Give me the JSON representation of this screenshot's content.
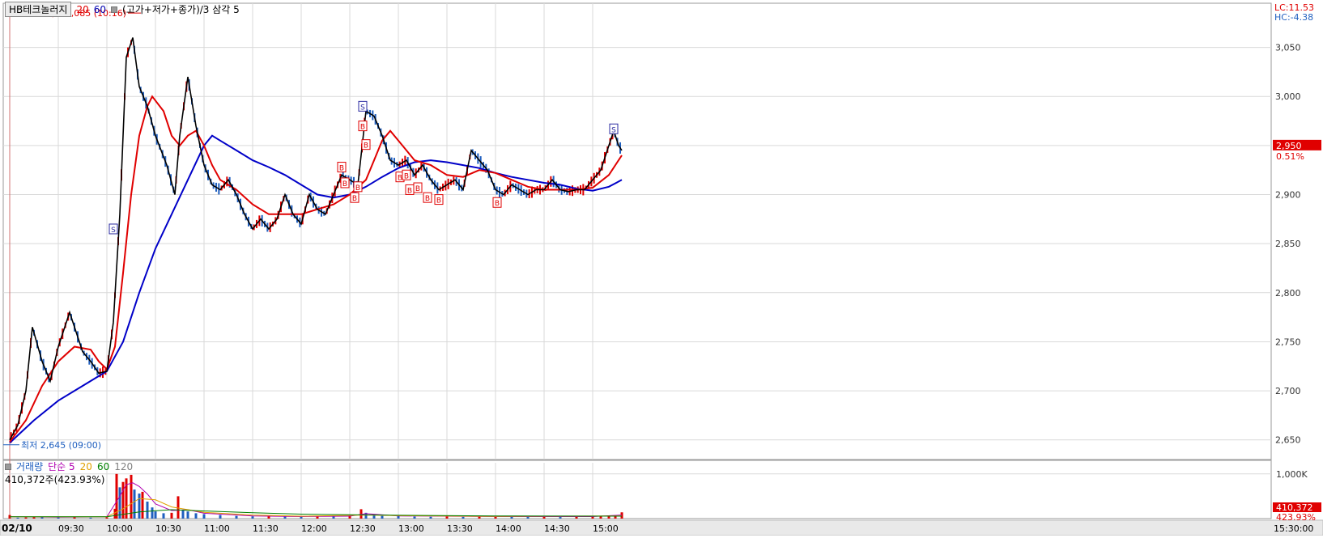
{
  "header": {
    "stock_name": "HB테크놀러지",
    "ma_short": "20",
    "ma_long": "60",
    "indicator": "(고가+저가+종가)/3 삼각 5",
    "lc_label": "LC:11.53",
    "hc_label": "HC:-4.38",
    "last_price_label": "2,950",
    "last_change_label": "0.51%",
    "high_annotation": "최고 3,085 (10:16)",
    "low_annotation": "최저 2,645 (09:00)"
  },
  "volume_panel": {
    "legend_title": "거래량",
    "legend_ma": "단순 5",
    "legend_20": "20",
    "legend_60": "60",
    "legend_120": "120",
    "summary": "410,372주(423.93%)",
    "axis_label": "1,000K",
    "last_volume_label": "410,372",
    "last_ratio_label": "423.93%"
  },
  "colors": {
    "up": "#e00000",
    "down": "#1f5fbf",
    "ma20": "#e00000",
    "ma60": "#0000c8",
    "triangle5": "#000000",
    "grid": "#d9d9d9"
  },
  "chart_data": {
    "type": "line",
    "date_label": "02/10",
    "x_ticks": [
      "09:30",
      "10:00",
      "10:30",
      "11:00",
      "11:30",
      "12:00",
      "12:30",
      "13:00",
      "13:30",
      "14:00",
      "14:30",
      "15:00",
      "15:30:00"
    ],
    "y_ticks": [
      2650,
      2700,
      2750,
      2800,
      2850,
      2900,
      2950,
      3000,
      3050
    ],
    "y_tick_labels": [
      "2,650",
      "2,700",
      "2,750",
      "2,800",
      "2,850",
      "2,900",
      "2,950",
      "3,000",
      "3,050"
    ],
    "ylim": [
      2630,
      3095
    ],
    "xlim": [
      "09:00",
      "15:30"
    ],
    "high": {
      "time": "10:16",
      "value": 3085
    },
    "low": {
      "time": "09:00",
      "value": 2645
    },
    "price_path": [
      [
        "09:00",
        2650
      ],
      [
        "09:05",
        2665
      ],
      [
        "09:10",
        2700
      ],
      [
        "09:14",
        2765
      ],
      [
        "09:20",
        2730
      ],
      [
        "09:25",
        2710
      ],
      [
        "09:30",
        2745
      ],
      [
        "09:37",
        2780
      ],
      [
        "09:45",
        2740
      ],
      [
        "09:50",
        2730
      ],
      [
        "09:55",
        2718
      ],
      [
        "10:00",
        2720
      ],
      [
        "10:04",
        2770
      ],
      [
        "10:08",
        2880
      ],
      [
        "10:12",
        3040
      ],
      [
        "10:16",
        3060
      ],
      [
        "10:20",
        3010
      ],
      [
        "10:25",
        2990
      ],
      [
        "10:30",
        2960
      ],
      [
        "10:37",
        2930
      ],
      [
        "10:42",
        2900
      ],
      [
        "10:45",
        2960
      ],
      [
        "10:50",
        3020
      ],
      [
        "10:55",
        2970
      ],
      [
        "11:00",
        2930
      ],
      [
        "11:05",
        2910
      ],
      [
        "11:10",
        2905
      ],
      [
        "11:15",
        2915
      ],
      [
        "11:20",
        2900
      ],
      [
        "11:25",
        2880
      ],
      [
        "11:30",
        2865
      ],
      [
        "11:35",
        2875
      ],
      [
        "11:40",
        2865
      ],
      [
        "11:45",
        2875
      ],
      [
        "11:50",
        2900
      ],
      [
        "11:55",
        2880
      ],
      [
        "12:00",
        2870
      ],
      [
        "12:05",
        2900
      ],
      [
        "12:10",
        2885
      ],
      [
        "12:15",
        2880
      ],
      [
        "12:20",
        2900
      ],
      [
        "12:25",
        2920
      ],
      [
        "12:30",
        2915
      ],
      [
        "12:35",
        2910
      ],
      [
        "12:40",
        2985
      ],
      [
        "12:45",
        2980
      ],
      [
        "12:50",
        2960
      ],
      [
        "12:55",
        2935
      ],
      [
        "13:00",
        2930
      ],
      [
        "13:05",
        2935
      ],
      [
        "13:10",
        2920
      ],
      [
        "13:15",
        2930
      ],
      [
        "13:20",
        2915
      ],
      [
        "13:25",
        2905
      ],
      [
        "13:30",
        2910
      ],
      [
        "13:35",
        2915
      ],
      [
        "13:40",
        2905
      ],
      [
        "13:45",
        2945
      ],
      [
        "13:50",
        2935
      ],
      [
        "13:55",
        2925
      ],
      [
        "14:00",
        2905
      ],
      [
        "14:05",
        2900
      ],
      [
        "14:10",
        2910
      ],
      [
        "14:15",
        2905
      ],
      [
        "14:20",
        2900
      ],
      [
        "14:25",
        2905
      ],
      [
        "14:30",
        2905
      ],
      [
        "14:35",
        2915
      ],
      [
        "14:40",
        2905
      ],
      [
        "14:45",
        2903
      ],
      [
        "14:50",
        2905
      ],
      [
        "14:55",
        2905
      ],
      [
        "15:00",
        2915
      ],
      [
        "15:05",
        2925
      ],
      [
        "15:10",
        2950
      ],
      [
        "15:13",
        2965
      ],
      [
        "15:16",
        2950
      ],
      [
        "15:18",
        2945
      ]
    ],
    "series": [
      {
        "name": "20",
        "values": [
          [
            "09:00",
            2648
          ],
          [
            "09:10",
            2670
          ],
          [
            "09:20",
            2705
          ],
          [
            "09:30",
            2730
          ],
          [
            "09:40",
            2745
          ],
          [
            "09:50",
            2742
          ],
          [
            "09:55",
            2730
          ],
          [
            "10:00",
            2722
          ],
          [
            "10:05",
            2745
          ],
          [
            "10:10",
            2820
          ],
          [
            "10:15",
            2900
          ],
          [
            "10:20",
            2960
          ],
          [
            "10:25",
            2990
          ],
          [
            "10:28",
            3000
          ],
          [
            "10:35",
            2985
          ],
          [
            "10:40",
            2960
          ],
          [
            "10:45",
            2950
          ],
          [
            "10:50",
            2960
          ],
          [
            "10:55",
            2965
          ],
          [
            "11:00",
            2950
          ],
          [
            "11:05",
            2930
          ],
          [
            "11:10",
            2915
          ],
          [
            "11:20",
            2905
          ],
          [
            "11:30",
            2890
          ],
          [
            "11:40",
            2880
          ],
          [
            "11:50",
            2880
          ],
          [
            "12:00",
            2880
          ],
          [
            "12:10",
            2885
          ],
          [
            "12:20",
            2890
          ],
          [
            "12:30",
            2900
          ],
          [
            "12:40",
            2915
          ],
          [
            "12:45",
            2935
          ],
          [
            "12:50",
            2955
          ],
          [
            "12:55",
            2965
          ],
          [
            "13:00",
            2955
          ],
          [
            "13:05",
            2945
          ],
          [
            "13:10",
            2935
          ],
          [
            "13:20",
            2930
          ],
          [
            "13:30",
            2920
          ],
          [
            "13:40",
            2918
          ],
          [
            "13:50",
            2925
          ],
          [
            "14:00",
            2922
          ],
          [
            "14:10",
            2915
          ],
          [
            "14:20",
            2908
          ],
          [
            "14:30",
            2905
          ],
          [
            "14:40",
            2905
          ],
          [
            "14:50",
            2905
          ],
          [
            "15:00",
            2907
          ],
          [
            "15:10",
            2920
          ],
          [
            "15:18",
            2940
          ]
        ]
      },
      {
        "name": "60",
        "values": [
          [
            "09:00",
            2647
          ],
          [
            "09:15",
            2670
          ],
          [
            "09:30",
            2690
          ],
          [
            "09:45",
            2705
          ],
          [
            "10:00",
            2720
          ],
          [
            "10:10",
            2750
          ],
          [
            "10:20",
            2800
          ],
          [
            "10:30",
            2845
          ],
          [
            "10:40",
            2880
          ],
          [
            "10:50",
            2915
          ],
          [
            "11:00",
            2950
          ],
          [
            "11:05",
            2960
          ],
          [
            "11:10",
            2955
          ],
          [
            "11:20",
            2945
          ],
          [
            "11:30",
            2935
          ],
          [
            "11:40",
            2928
          ],
          [
            "11:50",
            2920
          ],
          [
            "12:00",
            2910
          ],
          [
            "12:10",
            2900
          ],
          [
            "12:20",
            2897
          ],
          [
            "12:30",
            2900
          ],
          [
            "12:40",
            2908
          ],
          [
            "12:50",
            2918
          ],
          [
            "13:00",
            2927
          ],
          [
            "13:10",
            2933
          ],
          [
            "13:20",
            2935
          ],
          [
            "13:30",
            2933
          ],
          [
            "13:40",
            2930
          ],
          [
            "13:50",
            2927
          ],
          [
            "14:00",
            2922
          ],
          [
            "14:10",
            2918
          ],
          [
            "14:20",
            2915
          ],
          [
            "14:30",
            2912
          ],
          [
            "14:40",
            2910
          ],
          [
            "14:50",
            2906
          ],
          [
            "15:00",
            2904
          ],
          [
            "15:10",
            2908
          ],
          [
            "15:18",
            2915
          ]
        ]
      }
    ],
    "signals": [
      {
        "type": "S",
        "time": "10:04",
        "value": 2865
      },
      {
        "type": "S",
        "time": "12:38",
        "value": 2990
      },
      {
        "type": "S",
        "time": "15:13",
        "value": 2967
      },
      {
        "type": "B",
        "time": "12:25",
        "value": 2928
      },
      {
        "type": "B",
        "time": "12:27",
        "value": 2912
      },
      {
        "type": "B",
        "time": "12:33",
        "value": 2897
      },
      {
        "type": "B",
        "time": "12:35",
        "value": 2908
      },
      {
        "type": "B",
        "time": "12:38",
        "value": 2970
      },
      {
        "type": "B",
        "time": "12:40",
        "value": 2951
      },
      {
        "type": "B",
        "time": "13:01",
        "value": 2918
      },
      {
        "type": "B",
        "time": "13:05",
        "value": 2920
      },
      {
        "type": "B",
        "time": "13:07",
        "value": 2905
      },
      {
        "type": "B",
        "time": "13:12",
        "value": 2907
      },
      {
        "type": "B",
        "time": "13:18",
        "value": 2897
      },
      {
        "type": "B",
        "time": "13:25",
        "value": 2895
      },
      {
        "type": "B",
        "time": "14:01",
        "value": 2892
      }
    ],
    "volume": {
      "ylabel_tick": "1,000K",
      "ylim_k": [
        0,
        1250
      ],
      "bars_k": [
        [
          "09:00",
          80
        ],
        [
          "09:05",
          20
        ],
        [
          "09:10",
          25
        ],
        [
          "09:15",
          40
        ],
        [
          "09:20",
          30
        ],
        [
          "09:30",
          25
        ],
        [
          "09:40",
          35
        ],
        [
          "09:50",
          20
        ],
        [
          "10:00",
          30
        ],
        [
          "10:05",
          220
        ],
        [
          "10:06",
          1000
        ],
        [
          "10:08",
          700
        ],
        [
          "10:10",
          820
        ],
        [
          "10:12",
          900
        ],
        [
          "10:15",
          980
        ],
        [
          "10:17",
          650
        ],
        [
          "10:20",
          560
        ],
        [
          "10:22",
          600
        ],
        [
          "10:25",
          380
        ],
        [
          "10:28",
          250
        ],
        [
          "10:30",
          160
        ],
        [
          "10:35",
          120
        ],
        [
          "10:40",
          130
        ],
        [
          "10:44",
          500
        ],
        [
          "10:47",
          200
        ],
        [
          "10:50",
          160
        ],
        [
          "10:55",
          120
        ],
        [
          "11:00",
          100
        ],
        [
          "11:10",
          80
        ],
        [
          "11:20",
          60
        ],
        [
          "11:30",
          50
        ],
        [
          "11:40",
          55
        ],
        [
          "11:50",
          45
        ],
        [
          "12:00",
          40
        ],
        [
          "12:10",
          50
        ],
        [
          "12:20",
          45
        ],
        [
          "12:30",
          60
        ],
        [
          "12:37",
          210
        ],
        [
          "12:40",
          130
        ],
        [
          "12:45",
          70
        ],
        [
          "12:50",
          60
        ],
        [
          "13:00",
          55
        ],
        [
          "13:10",
          45
        ],
        [
          "13:20",
          40
        ],
        [
          "13:30",
          45
        ],
        [
          "13:40",
          40
        ],
        [
          "13:50",
          45
        ],
        [
          "14:00",
          50
        ],
        [
          "14:10",
          40
        ],
        [
          "14:20",
          35
        ],
        [
          "14:30",
          40
        ],
        [
          "14:40",
          35
        ],
        [
          "14:50",
          40
        ],
        [
          "15:00",
          45
        ],
        [
          "15:05",
          50
        ],
        [
          "15:10",
          60
        ],
        [
          "15:14",
          70
        ],
        [
          "15:18",
          140
        ]
      ],
      "ma5_k": [
        [
          "09:00",
          40
        ],
        [
          "09:30",
          30
        ],
        [
          "10:00",
          40
        ],
        [
          "10:08",
          500
        ],
        [
          "10:12",
          760
        ],
        [
          "10:16",
          800
        ],
        [
          "10:20",
          720
        ],
        [
          "10:25",
          550
        ],
        [
          "10:30",
          330
        ],
        [
          "10:40",
          180
        ],
        [
          "10:50",
          200
        ],
        [
          "11:00",
          120
        ],
        [
          "11:30",
          60
        ],
        [
          "12:00",
          45
        ],
        [
          "12:30",
          55
        ],
        [
          "12:40",
          110
        ],
        [
          "13:00",
          60
        ],
        [
          "14:00",
          45
        ],
        [
          "15:00",
          45
        ],
        [
          "15:18",
          80
        ]
      ],
      "ma20_k": [
        [
          "09:00",
          40
        ],
        [
          "10:00",
          40
        ],
        [
          "10:10",
          220
        ],
        [
          "10:20",
          450
        ],
        [
          "10:30",
          420
        ],
        [
          "10:40",
          260
        ],
        [
          "11:00",
          140
        ],
        [
          "11:30",
          80
        ],
        [
          "12:00",
          55
        ],
        [
          "12:40",
          80
        ],
        [
          "13:00",
          65
        ],
        [
          "14:00",
          50
        ],
        [
          "15:18",
          60
        ]
      ],
      "ma60_k": [
        [
          "09:00",
          40
        ],
        [
          "10:00",
          40
        ],
        [
          "10:20",
          150
        ],
        [
          "10:40",
          200
        ],
        [
          "11:00",
          170
        ],
        [
          "11:30",
          130
        ],
        [
          "12:00",
          100
        ],
        [
          "12:30",
          85
        ],
        [
          "13:00",
          75
        ],
        [
          "14:00",
          60
        ],
        [
          "15:18",
          55
        ]
      ]
    }
  }
}
